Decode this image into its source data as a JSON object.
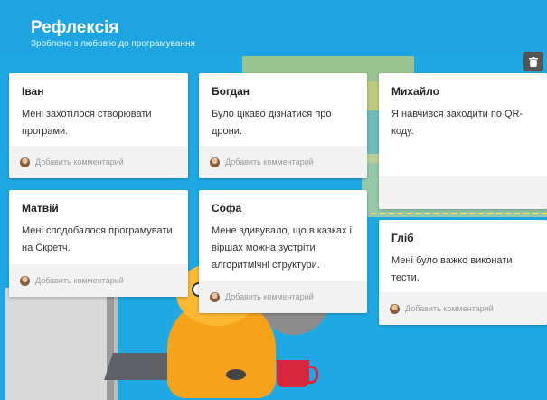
{
  "header": {
    "title": "Рефлексія",
    "subtitle": "Зроблено з любов'ю до програмування"
  },
  "cards": [
    {
      "name": "Іван",
      "text": "Мені захотілося створювати програми.",
      "comment_placeholder": "Добавить комментарий"
    },
    {
      "name": "Богдан",
      "text": "Було цікаво дізнатися про дрони.",
      "comment_placeholder": "Добавить комментарий"
    },
    {
      "name": "Михайло",
      "text": "Я навчився заходити по QR-коду.",
      "comment_placeholder": ""
    },
    {
      "name": "Матвій",
      "text": "Мені сподобалося програмувати на Скретч.",
      "comment_placeholder": "Добавить комментарий"
    },
    {
      "name": "Софа",
      "text": "Мене здивувало, що в казках і віршах можна зустріти алгоритмічні структури.",
      "comment_placeholder": "Добавить комментарий"
    },
    {
      "name": "Гліб",
      "text": "Мені було важко виконати тести.",
      "comment_placeholder": "Добавить комментарий"
    }
  ],
  "card_actions": [
    "upload-icon",
    "link-icon",
    "search-icon",
    "camera-icon",
    "more-icon"
  ],
  "colors": {
    "background": "#1fa9e4",
    "header": "#1ea5e1",
    "card": "#ffffff",
    "footer": "#f2f2f2"
  }
}
